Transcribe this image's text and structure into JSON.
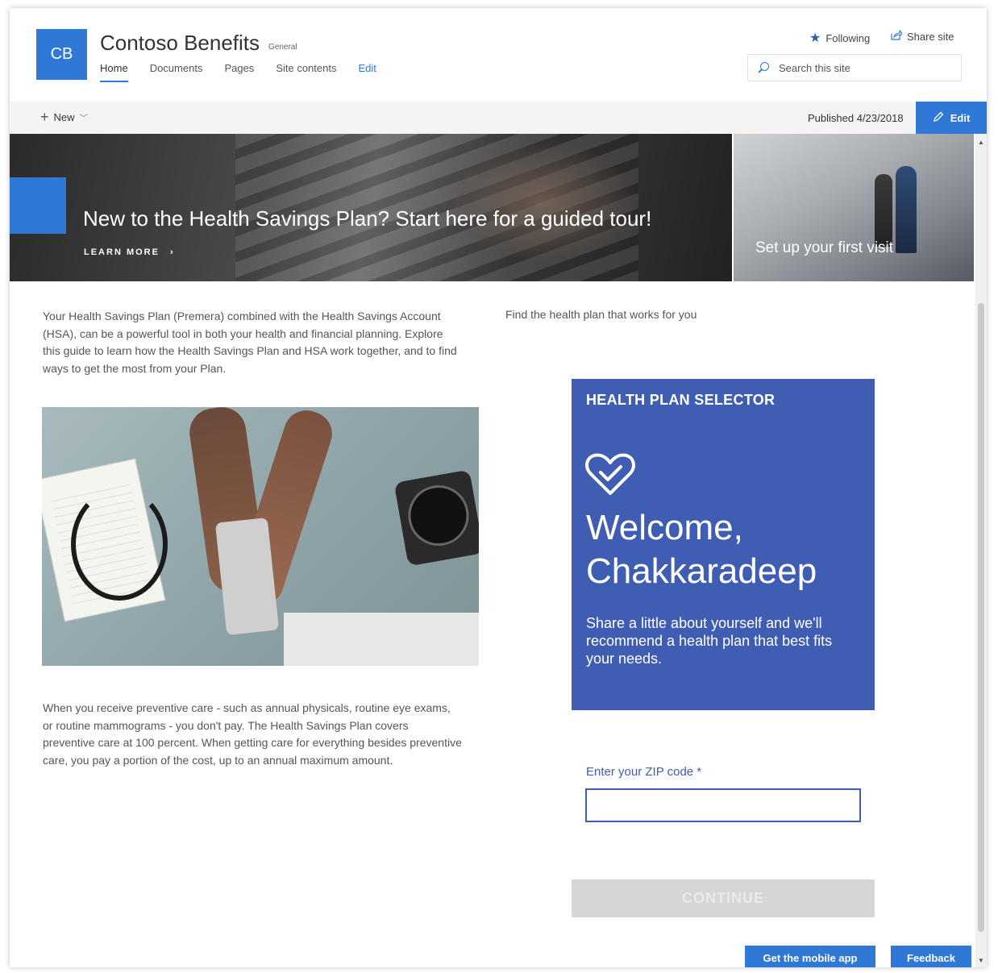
{
  "header": {
    "logo_text": "CB",
    "site_title": "Contoso Benefits",
    "site_classification": "General",
    "nav": [
      {
        "label": "Home",
        "active": true
      },
      {
        "label": "Documents"
      },
      {
        "label": "Pages"
      },
      {
        "label": "Site contents"
      },
      {
        "label": "Edit"
      }
    ],
    "following_label": "Following",
    "share_label": "Share site",
    "search_placeholder": "Search this site"
  },
  "command_bar": {
    "new_label": "New",
    "published_text": "Published 4/23/2018",
    "edit_label": "Edit"
  },
  "hero": {
    "main_title": "New to the Health Savings Plan? Start here for a guided tour!",
    "main_link": "LEARN MORE",
    "side_title": "Set up your first visit"
  },
  "content": {
    "intro": "Your Health Savings Plan (Premera) combined with the Health Savings Account (HSA), can be a powerful tool in both your health and financial planning. Explore this guide to learn how the Health Savings Plan and HSA work together, and to find ways to get the most from your Plan.",
    "find_text": "Find the health plan that works for you",
    "preventive": "When you receive preventive care - such as annual physicals, routine eye exams, or routine mammograms - you don't pay. The Health Savings Plan covers preventive care at 100 percent. When getting care for everything besides preventive care, you pay a portion of the cost, up to an annual maximum amount."
  },
  "selector": {
    "heading": "HEALTH PLAN SELECTOR",
    "welcome_line1": "Welcome,",
    "welcome_line2": "Chakkaradeep",
    "description": "Share a little about yourself and we'll recommend a health plan that best fits your needs.",
    "zip_label": "Enter your ZIP code *",
    "zip_value": "",
    "continue_label": "CONTINUE"
  },
  "footer_buttons": {
    "mobile_app": "Get the mobile app",
    "feedback": "Feedback"
  },
  "colors": {
    "accent": "#2f78d6",
    "selector_bg": "#3f5db2",
    "disabled_button": "#d6d6d6"
  },
  "icons": [
    "star-icon",
    "share-icon",
    "search-icon",
    "plus-icon",
    "chevron-down-icon",
    "pencil-icon",
    "chevron-right-icon",
    "heart-check-icon"
  ]
}
